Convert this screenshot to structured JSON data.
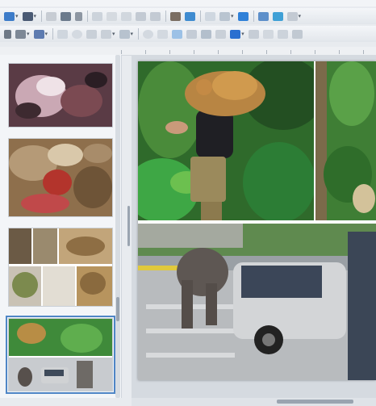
{
  "toolbar_row1_icons": [
    "new-slide-icon",
    "save-icon",
    "export-pdf-icon",
    "print-icon",
    "cut-icon",
    "copy-icon",
    "paste-icon",
    "clone-format-icon",
    "undo-icon",
    "redo-icon",
    "find-icon",
    "spellcheck-icon",
    "grid-icon",
    "display-views-icon",
    "table-icon",
    "image-icon",
    "chart-icon",
    "textbox-icon"
  ],
  "toolbar_row2_icons": [
    "select-icon",
    "zoom-icon",
    "line-icon",
    "rectangle-icon",
    "ellipse-icon",
    "arrow-icon",
    "curve-icon",
    "connector-icon",
    "basic-shapes-icon",
    "symbol-shapes-icon",
    "block-arrows-icon",
    "flowchart-icon",
    "callouts-icon",
    "stars-icon",
    "3d-objects-icon",
    "rotate-icon",
    "align-icon",
    "arrange-icon",
    "shadow-icon"
  ],
  "slide_panel": {
    "thumbnails": [
      {
        "name": "slide-thumbnail-1",
        "selected": false
      },
      {
        "name": "slide-thumbnail-2",
        "selected": false
      },
      {
        "name": "slide-thumbnail-3",
        "selected": false
      },
      {
        "name": "slide-thumbnail-4",
        "selected": true
      }
    ]
  },
  "colors": {
    "accent": "#4f86c6",
    "toolbar_bg": "#e8ecf0",
    "panel_bg": "#f3f5f8",
    "workspace_bg": "#d5dae0"
  }
}
